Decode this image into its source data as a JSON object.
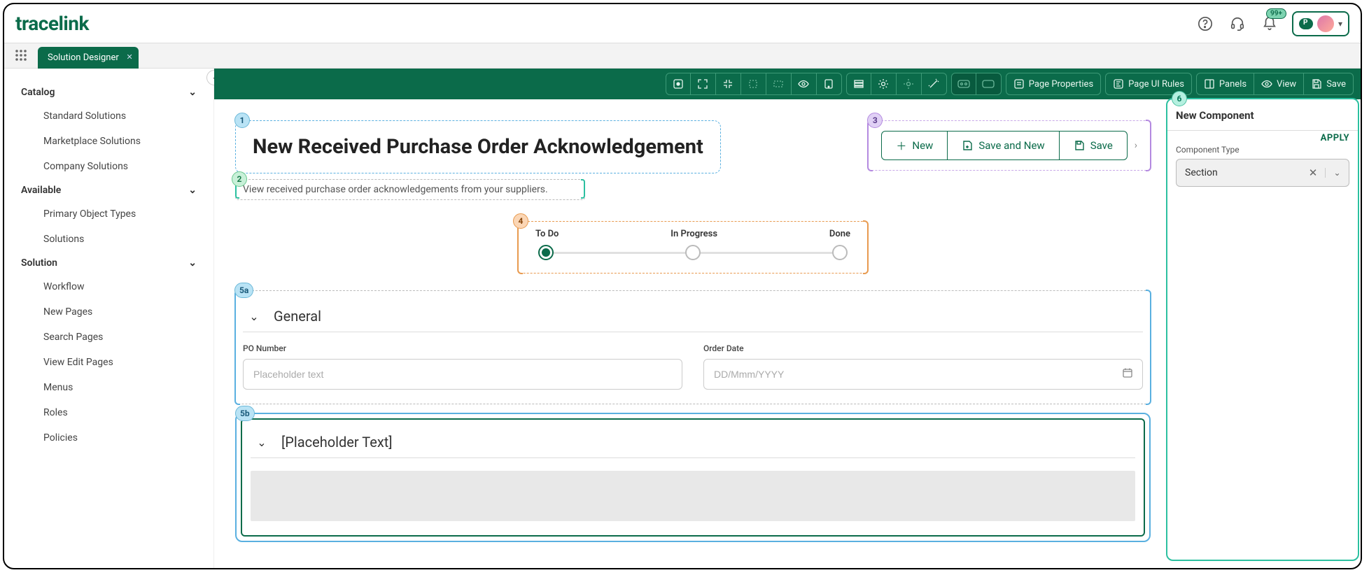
{
  "brand": "tracelink",
  "notifications_badge": "99+",
  "tab": {
    "label": "Solution Designer"
  },
  "sidebar": {
    "groups": [
      {
        "label": "Catalog",
        "items": [
          "Standard Solutions",
          "Marketplace Solutions",
          "Company Solutions"
        ]
      },
      {
        "label": "Available",
        "items": [
          "Primary Object Types",
          "Solutions"
        ]
      },
      {
        "label": "Solution",
        "items": [
          "Workflow",
          "New Pages",
          "Search Pages",
          "View Edit Pages",
          "Menus",
          "Roles",
          "Policies"
        ]
      }
    ]
  },
  "toolbar": {
    "page_properties": "Page Properties",
    "page_ui_rules": "Page UI Rules",
    "panels": "Panels",
    "view": "View",
    "save": "Save"
  },
  "callouts": {
    "c1": "1",
    "c2": "2",
    "c3": "3",
    "c4": "4",
    "c5a": "5a",
    "c5b": "5b",
    "c6": "6"
  },
  "page_title": "New Received Purchase Order Acknowledgement",
  "subtitle": "View received purchase order acknowledgements from your suppliers.",
  "actions": {
    "new": "New",
    "save_and_new": "Save and New",
    "save": "Save"
  },
  "stepper": {
    "steps": [
      "To Do",
      "In Progress",
      "Done"
    ]
  },
  "section_a": {
    "title": "General",
    "fields": {
      "po_number_label": "PO Number",
      "po_number_placeholder": "Placeholder text",
      "order_date_label": "Order  Date",
      "order_date_placeholder": "DD/Mmm/YYYY"
    }
  },
  "section_b": {
    "title": "[Placeholder Text]"
  },
  "props": {
    "title": "New Component",
    "apply": "APPLY",
    "component_type_label": "Component Type",
    "component_type_value": "Section"
  }
}
